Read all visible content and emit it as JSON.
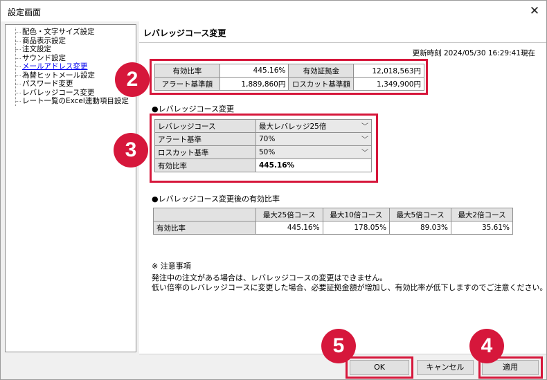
{
  "window": {
    "title": "設定画面"
  },
  "tree": {
    "items": [
      {
        "label": "配色・文字サイズ設定"
      },
      {
        "label": "商品表示設定"
      },
      {
        "label": "注文設定"
      },
      {
        "label": "サウンド設定"
      },
      {
        "label": "メールアドレス変更"
      },
      {
        "label": "為替ヒットメール設定"
      },
      {
        "label": "パスワード変更"
      },
      {
        "label": "レバレッジコース変更"
      },
      {
        "label": "レート一覧のExcel連動項目設定"
      }
    ]
  },
  "main": {
    "title": "レバレッジコース変更",
    "updated": "更新時刻 2024/05/30 16:29:41現在"
  },
  "summary": {
    "r1": {
      "l1": "有効比率",
      "v1": "445.16%",
      "l2": "有効証拠金",
      "v2": "12,018,563円"
    },
    "r2": {
      "l1": "アラート基準額",
      "v1": "1,889,860円",
      "l2": "ロスカット基準額",
      "v2": "1,349,900円"
    }
  },
  "leverage": {
    "heading": "●レバレッジコース変更",
    "rows": [
      {
        "label": "レバレッジコース",
        "value": "最大レバレッジ25倍"
      },
      {
        "label": "アラート基準",
        "value": "70%"
      },
      {
        "label": "ロスカット基準",
        "value": "50%"
      },
      {
        "label": "有効比率",
        "value": "445.16%"
      }
    ]
  },
  "after": {
    "heading": "●レバレッジコース変更後の有効比率",
    "headers": [
      "最大25倍コース",
      "最大10倍コース",
      "最大5倍コース",
      "最大2倍コース"
    ],
    "row_label": "有効比率",
    "values": [
      "445.16%",
      "178.05%",
      "89.03%",
      "35.61%"
    ]
  },
  "notes": {
    "title": "※ 注意事項",
    "line1": "発注中の注文がある場合は、レバレッジコースの変更はできません。",
    "line2": "低い倍率のレバレッジコースに変更した場合、必要証拠金額が増加し、有効比率が低下しますのでご注意ください。"
  },
  "buttons": {
    "ok": "OK",
    "cancel": "キャンセル",
    "apply": "適用"
  },
  "badges": {
    "b2": "2",
    "b3": "3",
    "b4": "4",
    "b5": "5"
  },
  "icons": {
    "close": "close-icon",
    "dropdown": "chevron-down-icon"
  },
  "colors": {
    "highlight": "#d6173b",
    "link": "#0000ee"
  }
}
